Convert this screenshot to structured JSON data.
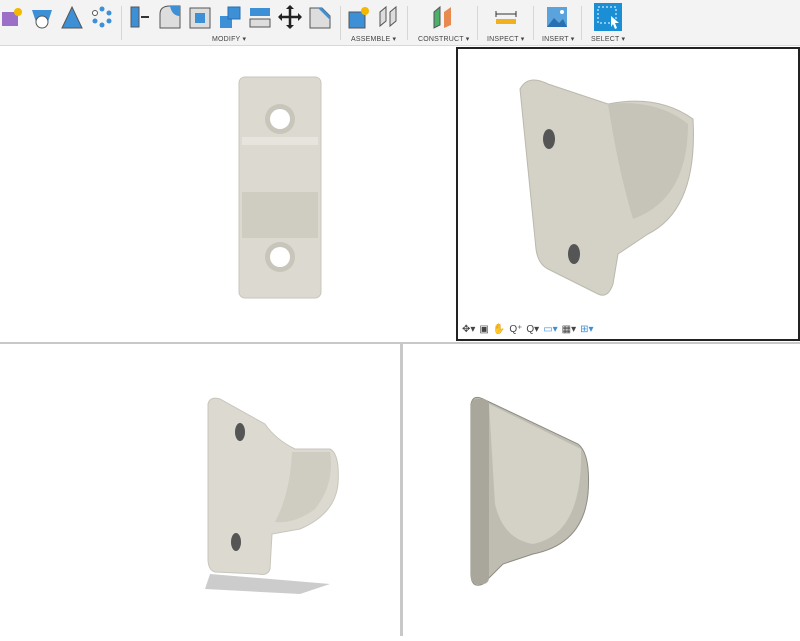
{
  "toolbar": {
    "groups": {
      "modify": "MODIFY ▾",
      "assemble": "ASSEMBLE ▾",
      "construct": "CONSTRUCT ▾",
      "inspect": "INSPECT ▾",
      "insert": "INSERT ▾",
      "select": "SELECT ▾"
    }
  },
  "nav_bar": {
    "orbit": "✥▾",
    "look_at": "▣",
    "pan": "✋",
    "zoom": "Q⁺",
    "fit": "Q▾",
    "display": "▭▾",
    "grid": "▦▾",
    "viewports": "⊞▾"
  },
  "colors": {
    "accent": "#1a8fd6",
    "part": "#dcdad0",
    "toolbar_bg": "#f3f3f3"
  }
}
